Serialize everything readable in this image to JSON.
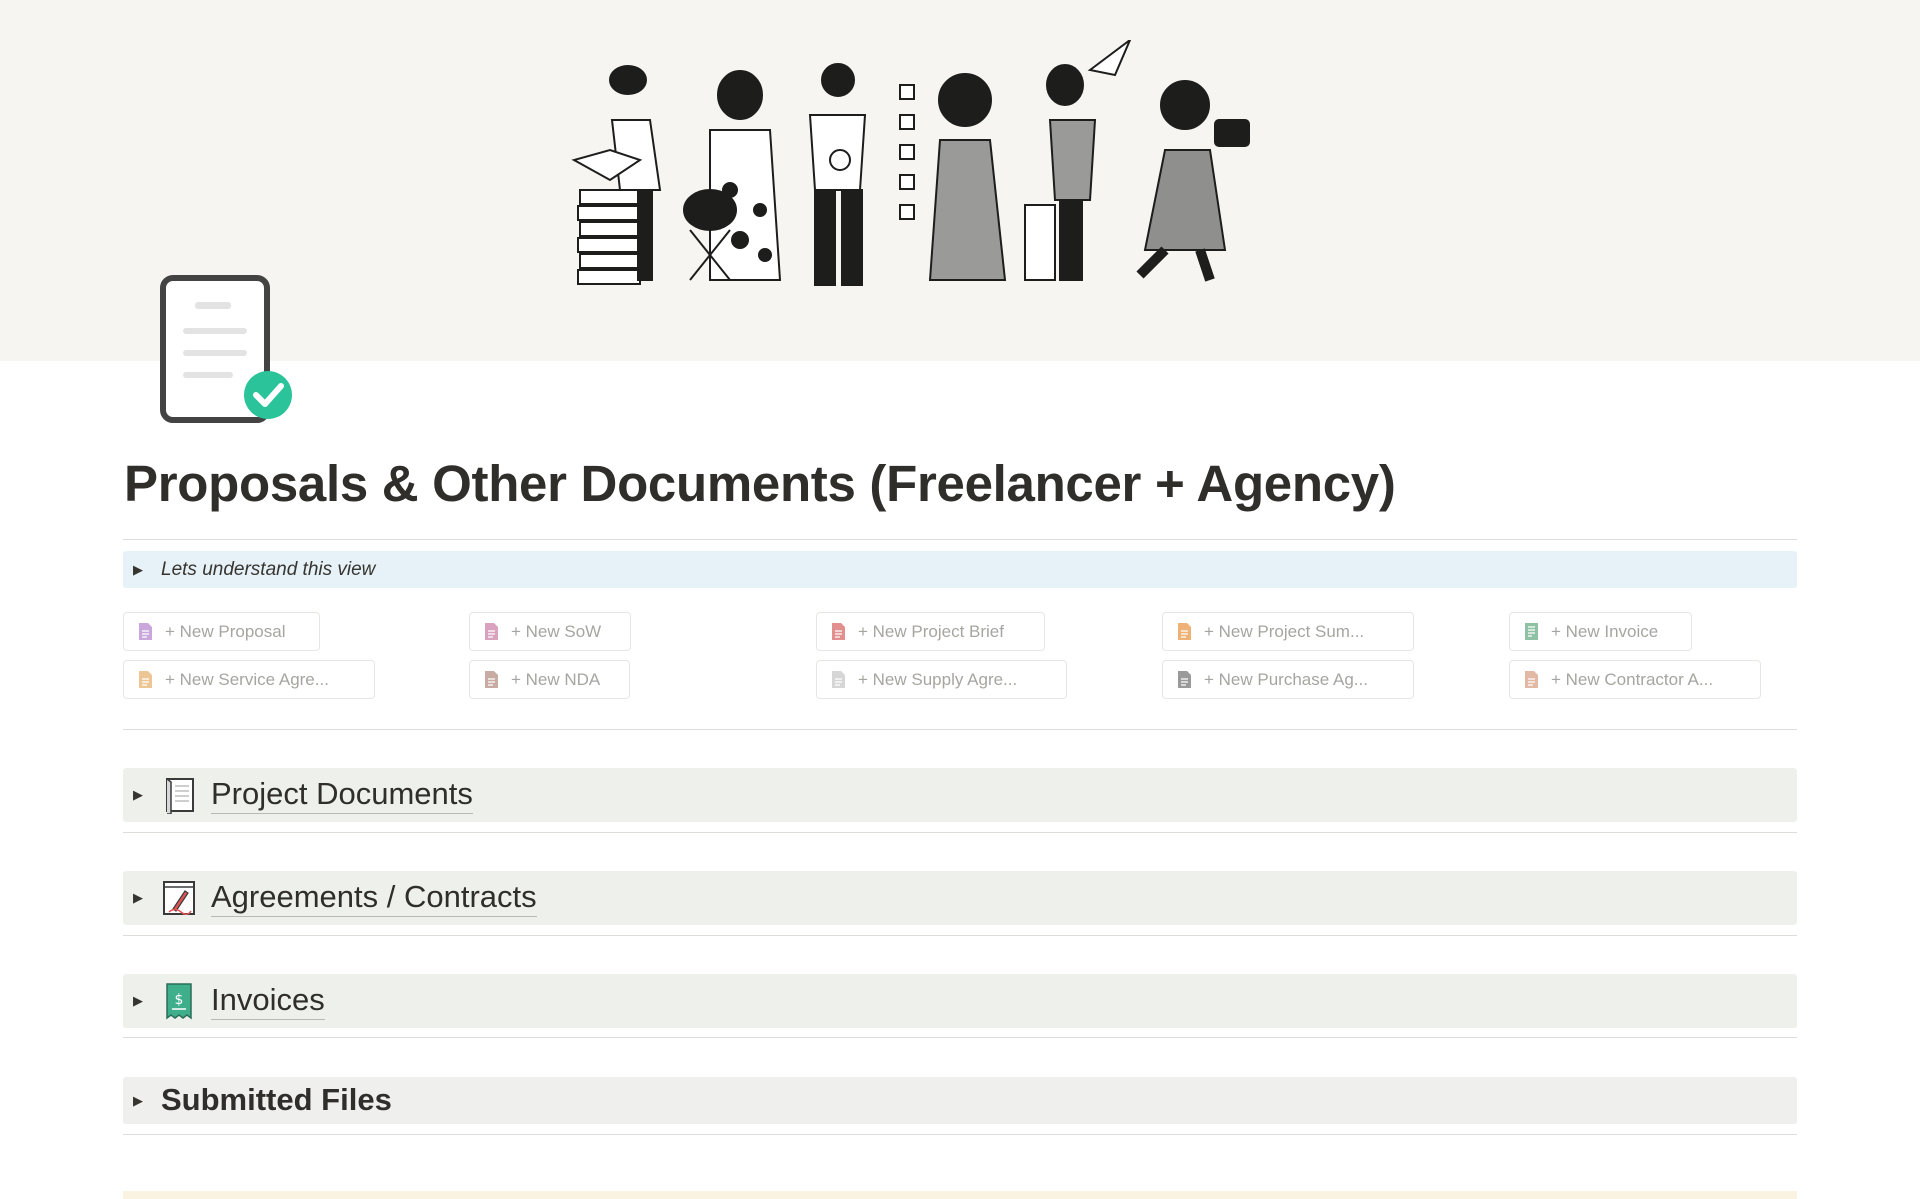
{
  "page": {
    "title": "Proposals & Other Documents (Freelancer + Agency)",
    "icon": "document-check-icon",
    "cover": "people-illustration"
  },
  "callout": {
    "text": "Lets understand this view",
    "icon": "toggle-triangle-icon"
  },
  "template_buttons": [
    {
      "label": "+ New Proposal",
      "icon": "document-icon",
      "color": "#c9a7dc"
    },
    {
      "label": "+ New SoW",
      "icon": "document-icon",
      "color": "#d9a3c0"
    },
    {
      "label": "+ New Project Brief",
      "icon": "document-icon",
      "color": "#e28f8f"
    },
    {
      "label": "+ New Project Sum...",
      "icon": "document-icon",
      "color": "#eeb277"
    },
    {
      "label": "+ New Invoice",
      "icon": "invoice-icon",
      "color": "#8fc2a5"
    },
    {
      "label": "+ New Service Agre...",
      "icon": "document-icon",
      "color": "#ecc795"
    },
    {
      "label": "+ New NDA",
      "icon": "document-icon",
      "color": "#c8aca3"
    },
    {
      "label": "+ New Supply Agre...",
      "icon": "document-icon",
      "color": "#d6d6d6"
    },
    {
      "label": "+ New Purchase Ag...",
      "icon": "document-icon",
      "color": "#9a9a9a"
    },
    {
      "label": "+ New Contractor A...",
      "icon": "document-icon",
      "color": "#e2b9a4"
    }
  ],
  "sections": [
    {
      "label": "Project Documents",
      "icon": "notebook-icon"
    },
    {
      "label": "Agreements / Contracts",
      "icon": "contract-pen-icon"
    },
    {
      "label": "Invoices",
      "icon": "receipt-icon"
    },
    {
      "label": "Submitted Files",
      "icon": ""
    }
  ]
}
